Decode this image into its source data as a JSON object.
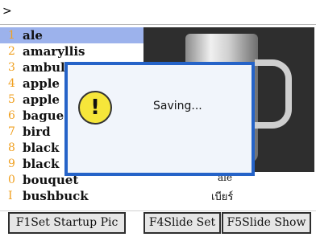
{
  "topbar": {
    "cursor": ">"
  },
  "list": {
    "items": [
      {
        "num": "1",
        "word": "ale",
        "selected": true
      },
      {
        "num": "2",
        "word": "amaryllis"
      },
      {
        "num": "3",
        "word": "ambul"
      },
      {
        "num": "4",
        "word": "apple"
      },
      {
        "num": "5",
        "word": "apple"
      },
      {
        "num": "6",
        "word": "bague"
      },
      {
        "num": "7",
        "word": "bird"
      },
      {
        "num": "8",
        "word": "black"
      },
      {
        "num": "9",
        "word": "black"
      },
      {
        "num": "0",
        "word": "bouquet"
      },
      {
        "num": "I",
        "word": "bushbuck"
      }
    ]
  },
  "preview": {
    "word_en": "ale",
    "word_th": "เบียร์"
  },
  "dialog": {
    "message": "Saving...",
    "icon": "warning-icon"
  },
  "softkeys": {
    "f1": "F1Set Startup Pic",
    "f4": "F4Slide Set",
    "f5": "F5Slide Show"
  },
  "colors": {
    "selection": "#9cb2ec",
    "dialog_border": "#2563c8",
    "number": "#f0a020",
    "warning": "#f6e63a"
  }
}
